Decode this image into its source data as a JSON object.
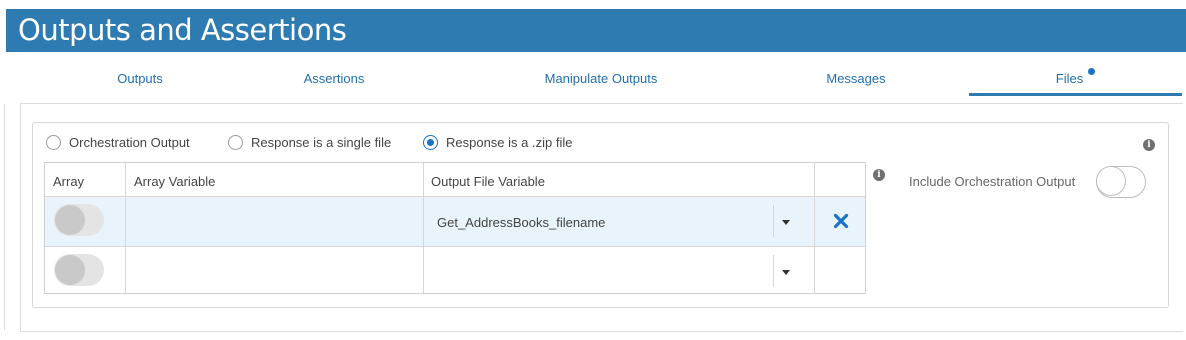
{
  "header": {
    "title": "Outputs and Assertions"
  },
  "tabs": [
    {
      "label": "Outputs",
      "active": false
    },
    {
      "label": "Assertions",
      "active": false
    },
    {
      "label": "Manipulate Outputs",
      "active": false
    },
    {
      "label": "Messages",
      "active": false
    },
    {
      "label": "Files",
      "active": true,
      "dot": true
    }
  ],
  "response_options": [
    {
      "label": "Orchestration Output",
      "checked": false
    },
    {
      "label": "Response is a single file",
      "checked": false
    },
    {
      "label": "Response is a .zip file",
      "checked": true
    }
  ],
  "grid": {
    "columns": [
      "Array",
      "Array Variable",
      "Output File Variable"
    ],
    "rows": [
      {
        "array": false,
        "array_variable": "",
        "output_file_variable": "Get_AddressBooks_filename",
        "removable": true
      },
      {
        "array": false,
        "array_variable": "",
        "output_file_variable": "",
        "removable": false
      }
    ]
  },
  "include_orchestration": {
    "label": "Include Orchestration Output",
    "enabled": false
  },
  "colors": {
    "header_bg": "#2d7bb0",
    "accent": "#1a73c4",
    "selected_row": "#e8f3fb"
  },
  "icons": [
    "info-icon",
    "dropdown-caret-icon",
    "remove-x-icon"
  ]
}
